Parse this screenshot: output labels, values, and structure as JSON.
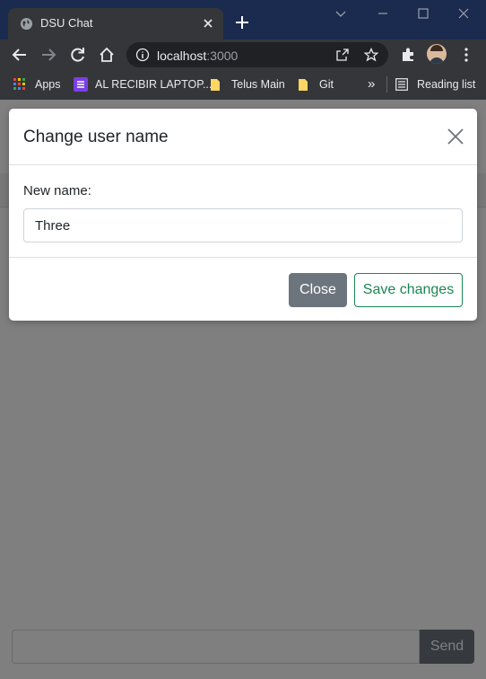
{
  "browser": {
    "tab": {
      "title": "DSU Chat"
    },
    "address": {
      "host": "localhost",
      "port": ":3000"
    },
    "bookmarks": [
      {
        "label": "Apps"
      },
      {
        "label": "AL RECIBIR LAPTOP..."
      },
      {
        "label": "Telus Main"
      },
      {
        "label": "Git"
      }
    ],
    "more_bookmarks": "»",
    "reading_list": "Reading list"
  },
  "chat": {
    "message_input": {
      "value": "",
      "placeholder": ""
    },
    "send_label": "Send"
  },
  "modal": {
    "title": "Change user name",
    "field_label": "New name:",
    "name_value": "Three",
    "close_label": "Close",
    "save_label": "Save changes"
  },
  "colors": {
    "chrome_frame": "#1b2b4f",
    "chrome_toolbar": "#35363a",
    "secondary_button": "#6c757d",
    "success_outline": "#198754"
  }
}
